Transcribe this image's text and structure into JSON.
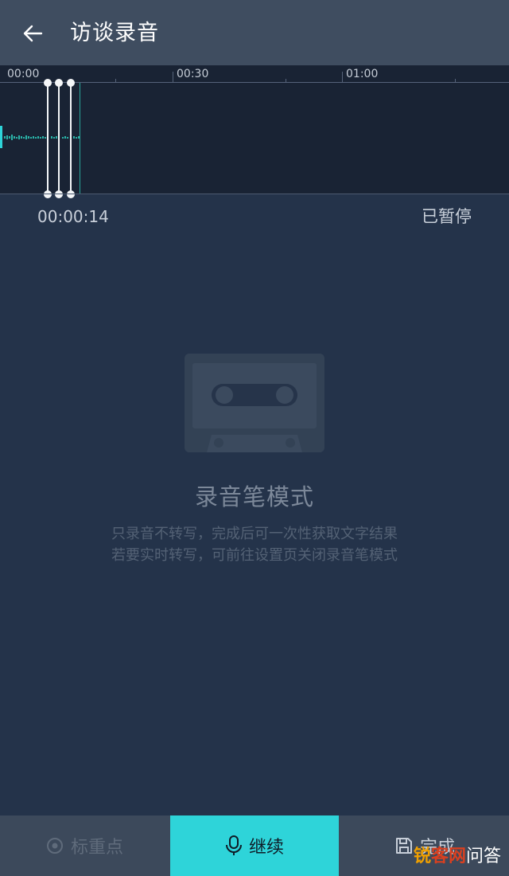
{
  "header": {
    "title": "访谈录音"
  },
  "timeline": {
    "ticks": [
      "00:00",
      "00:30",
      "01:00"
    ]
  },
  "status": {
    "elapsed": "00:00:14",
    "state": "已暂停"
  },
  "empty_state": {
    "icon": "cassette-icon",
    "title": "录音笔模式",
    "line1": "只录音不转写，完成后可一次性获取文字结果",
    "line2": "若要实时转写，可前往设置页关闭录音笔模式"
  },
  "bottom_bar": {
    "mark_label": "标重点",
    "continue_label": "继续",
    "finish_label": "完成"
  },
  "watermark": {
    "part1": "锐",
    "part2": "客网",
    "part3": "问答"
  },
  "colors": {
    "background": "#24334a",
    "app_bar": "#3f4d60",
    "wave_panel": "#192334",
    "accent": "#2ed4d9",
    "waveform": "#2ab3a8"
  }
}
